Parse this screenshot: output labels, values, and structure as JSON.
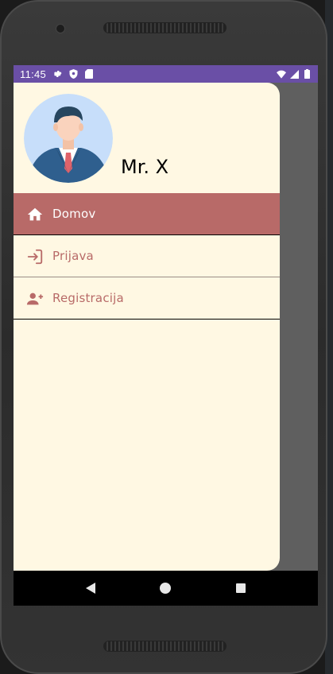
{
  "status_bar": {
    "time": "11:45",
    "color": "#6a4fa6",
    "left_icons": [
      "settings-icon",
      "shield-icon",
      "sd-card-icon"
    ],
    "right_icons": [
      "wifi-icon",
      "signal-icon",
      "battery-icon"
    ]
  },
  "drawer": {
    "user_name": "Mr. X",
    "avatar": "businessman-avatar",
    "background": "#fff8e3",
    "accent": "#b86a68",
    "items": [
      {
        "label": "Domov",
        "icon": "home-icon",
        "active": true
      },
      {
        "label": "Prijava",
        "icon": "login-icon",
        "active": false
      },
      {
        "label": "Registracija",
        "icon": "add-user-icon",
        "active": false
      }
    ]
  },
  "system_nav": {
    "buttons": [
      "back-icon",
      "home-circle-icon",
      "recents-icon"
    ]
  }
}
